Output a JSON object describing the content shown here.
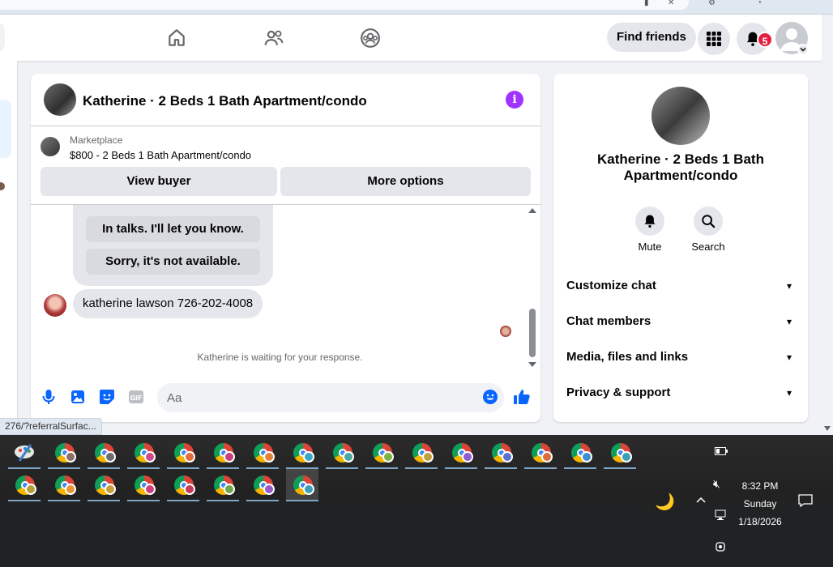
{
  "nav": {
    "find_friends": "Find friends",
    "notification_count": "5",
    "icons": [
      "home-icon",
      "friends-icon",
      "groups-icon",
      "menu-grid-icon",
      "bell-icon"
    ]
  },
  "chat": {
    "title": "Katherine · 2 Beds 1 Bath Apartment/condo",
    "marketplace_label": "Marketplace",
    "listing": "$800 - 2 Beds 1 Bath Apartment/condo",
    "view_buyer": "View buyer",
    "more_options": "More options",
    "quick_replies": [
      "In talks. I'll let you know.",
      "Sorry, it's not available."
    ],
    "last_message": "katherine lawson 726-202-4008",
    "waiting_text": "Katherine is waiting for your response.",
    "input_placeholder": "Aa"
  },
  "info_panel": {
    "title": "Katherine · 2 Beds 1 Bath Apartment/condo",
    "mute": "Mute",
    "search": "Search",
    "sections": [
      "Customize chat",
      "Chat members",
      "Media, files and links",
      "Privacy & support"
    ]
  },
  "status_url": "276/?referralSurfac...",
  "taskbar": {
    "time": "8:32 PM",
    "day": "Sunday",
    "date": "1/18/2026"
  },
  "colors": {
    "messenger_purple": "#a033ff",
    "fb_blue": "#0866ff",
    "badge_red": "#e41e3f"
  }
}
